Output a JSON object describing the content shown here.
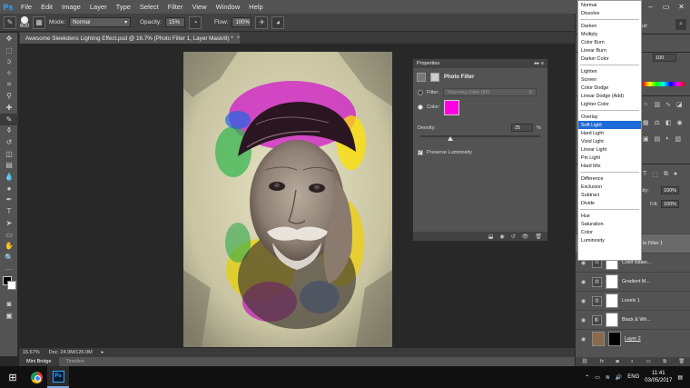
{
  "app": {
    "logo": "Ps"
  },
  "menu": [
    "File",
    "Edit",
    "Image",
    "Layer",
    "Type",
    "Select",
    "Filter",
    "View",
    "Window",
    "Help"
  ],
  "options": {
    "brush_size": "600",
    "mode_label": "Mode:",
    "mode_value": "Normal",
    "opacity_label": "Opacity:",
    "opacity_value": "15%",
    "flow_label": "Flow:",
    "flow_value": "100%"
  },
  "document": {
    "tab_title": "Awesome Sleekdens Lighting Effect.psd @ 16.7% (Photo Filter 1, Layer Mask/8) *",
    "tab_close": "×",
    "zoom": "16.67%",
    "doc_size": "Doc: 24.9M/126.0M"
  },
  "bottom_tabs": [
    "Mini Bridge",
    "Timeline"
  ],
  "properties": {
    "header": "Properties",
    "title": "Photo Filter",
    "filter_label": "Filter:",
    "filter_value": "Warming Filter (85)",
    "color_label": "Color:",
    "color_hex": "#ff00e1",
    "density_label": "Density:",
    "density_value": "25",
    "density_unit": "%",
    "density_level": 0.25,
    "preserve_luminosity": "Preserve Luminosity",
    "preserve_checked": true
  },
  "blend_modes": [
    [
      "Normal",
      "Dissolve"
    ],
    [
      "Darken",
      "Multiply",
      "Color Burn",
      "Linear Burn",
      "Darker Color"
    ],
    [
      "Lighten",
      "Screen",
      "Color Dodge",
      "Linear Dodge (Add)",
      "Lighter Color"
    ],
    [
      "Overlay",
      "Soft Light",
      "Hard Light",
      "Vivid Light",
      "Linear Light",
      "Pin Light",
      "Hard Mix"
    ],
    [
      "Difference",
      "Exclusion",
      "Subtract",
      "Divide"
    ],
    [
      "Hue",
      "Saturation",
      "Color",
      "Luminosity"
    ]
  ],
  "blend_selected": "Soft Light",
  "right_panel": {
    "partial_label": "ult",
    "zoom_value": "100",
    "opacity_label": "acity:",
    "opacity_value": "100%",
    "fill_label": "Fill:",
    "fill_value": "100%",
    "layers": [
      {
        "name": "to Filter 1",
        "selected": true
      },
      {
        "name": "Color Balan..."
      },
      {
        "name": "Gradient M..."
      },
      {
        "name": "Levels 1"
      },
      {
        "name": "Black & Wh..."
      },
      {
        "name": "Layer 2"
      }
    ]
  },
  "taskbar": {
    "language": "ENG",
    "time": "11:41",
    "date": "03/05/2017"
  }
}
